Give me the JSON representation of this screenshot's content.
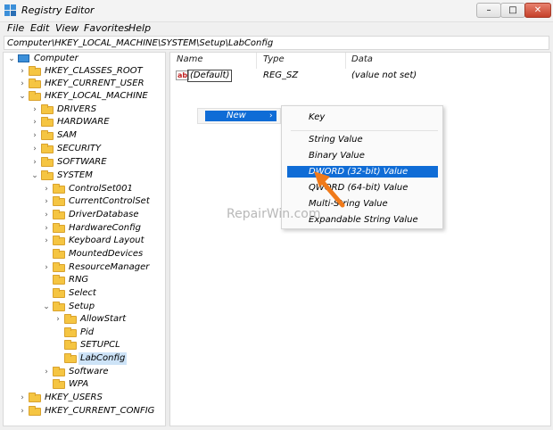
{
  "window": {
    "title": "Registry Editor",
    "min": "–",
    "max": "□",
    "close": "✕"
  },
  "menubar": [
    "File",
    "Edit",
    "View",
    "Favorites",
    "Help"
  ],
  "address": "Computer\\HKEY_LOCAL_MACHINE\\SYSTEM\\Setup\\LabConfig",
  "tree": [
    {
      "label": "Computer",
      "chev": "⌄",
      "icon": "computer-icon"
    },
    {
      "label": "HKEY_CLASSES_ROOT",
      "chev": "›"
    },
    {
      "label": "HKEY_CURRENT_USER",
      "chev": "›"
    },
    {
      "label": "HKEY_LOCAL_MACHINE",
      "chev": "⌄"
    },
    {
      "label": "DRIVERS",
      "chev": "›"
    },
    {
      "label": "HARDWARE",
      "chev": "›"
    },
    {
      "label": "SAM",
      "chev": "›"
    },
    {
      "label": "SECURITY",
      "chev": "›"
    },
    {
      "label": "SOFTWARE",
      "chev": "›"
    },
    {
      "label": "SYSTEM",
      "chev": "⌄"
    },
    {
      "label": "ControlSet001",
      "chev": "›"
    },
    {
      "label": "CurrentControlSet",
      "chev": "›"
    },
    {
      "label": "DriverDatabase",
      "chev": "›"
    },
    {
      "label": "HardwareConfig",
      "chev": "›"
    },
    {
      "label": "Keyboard Layout",
      "chev": "›"
    },
    {
      "label": "MountedDevices",
      "chev": ""
    },
    {
      "label": "ResourceManager",
      "chev": "›"
    },
    {
      "label": "RNG",
      "chev": ""
    },
    {
      "label": "Select",
      "chev": ""
    },
    {
      "label": "Setup",
      "chev": "⌄"
    },
    {
      "label": "AllowStart",
      "chev": "›"
    },
    {
      "label": "Pid",
      "chev": ""
    },
    {
      "label": "SETUPCL",
      "chev": ""
    },
    {
      "label": "LabConfig",
      "chev": ""
    },
    {
      "label": "Software",
      "chev": "›"
    },
    {
      "label": "WPA",
      "chev": ""
    },
    {
      "label": "HKEY_USERS",
      "chev": "›"
    },
    {
      "label": "HKEY_CURRENT_CONFIG",
      "chev": "›"
    }
  ],
  "columns": {
    "name": "Name",
    "type": "Type",
    "data": "Data"
  },
  "value_row": {
    "icon": "ab",
    "name": "(Default)",
    "type": "REG_SZ",
    "data": "(value not set)"
  },
  "context_menu": {
    "new_label": "New",
    "arrow": "›"
  },
  "submenu": [
    "Key",
    "String Value",
    "Binary Value",
    "DWORD (32-bit) Value",
    "QWORD (64-bit) Value",
    "Multi-String Value",
    "Expandable String Value"
  ],
  "watermark": "RepairWin.com",
  "colors": {
    "highlight": "#0f6cd6",
    "arrow": "#f07a1a",
    "folder": "#f5c542"
  }
}
